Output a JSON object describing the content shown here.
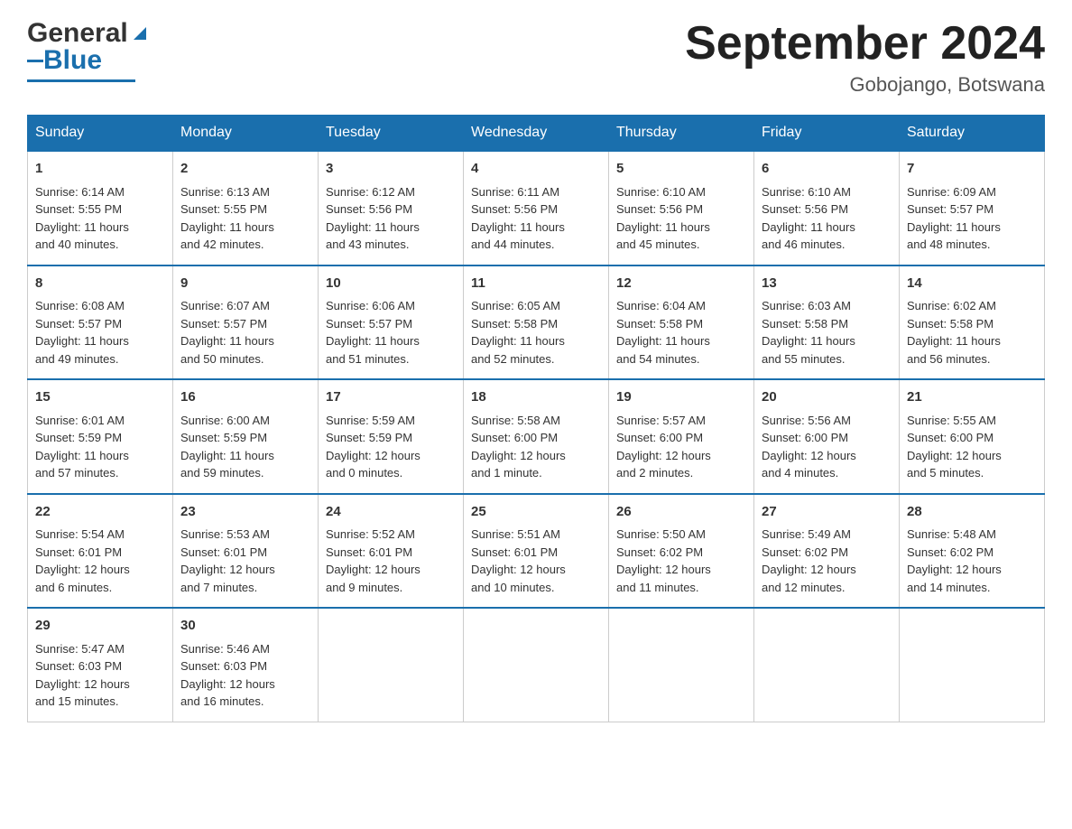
{
  "header": {
    "logo": {
      "general": "General",
      "blue": "Blue"
    },
    "title": "September 2024",
    "location": "Gobojango, Botswana"
  },
  "days_of_week": [
    "Sunday",
    "Monday",
    "Tuesday",
    "Wednesday",
    "Thursday",
    "Friday",
    "Saturday"
  ],
  "weeks": [
    [
      {
        "day": "1",
        "sunrise": "6:14 AM",
        "sunset": "5:55 PM",
        "daylight": "11 hours and 40 minutes."
      },
      {
        "day": "2",
        "sunrise": "6:13 AM",
        "sunset": "5:55 PM",
        "daylight": "11 hours and 42 minutes."
      },
      {
        "day": "3",
        "sunrise": "6:12 AM",
        "sunset": "5:56 PM",
        "daylight": "11 hours and 43 minutes."
      },
      {
        "day": "4",
        "sunrise": "6:11 AM",
        "sunset": "5:56 PM",
        "daylight": "11 hours and 44 minutes."
      },
      {
        "day": "5",
        "sunrise": "6:10 AM",
        "sunset": "5:56 PM",
        "daylight": "11 hours and 45 minutes."
      },
      {
        "day": "6",
        "sunrise": "6:10 AM",
        "sunset": "5:56 PM",
        "daylight": "11 hours and 46 minutes."
      },
      {
        "day": "7",
        "sunrise": "6:09 AM",
        "sunset": "5:57 PM",
        "daylight": "11 hours and 48 minutes."
      }
    ],
    [
      {
        "day": "8",
        "sunrise": "6:08 AM",
        "sunset": "5:57 PM",
        "daylight": "11 hours and 49 minutes."
      },
      {
        "day": "9",
        "sunrise": "6:07 AM",
        "sunset": "5:57 PM",
        "daylight": "11 hours and 50 minutes."
      },
      {
        "day": "10",
        "sunrise": "6:06 AM",
        "sunset": "5:57 PM",
        "daylight": "11 hours and 51 minutes."
      },
      {
        "day": "11",
        "sunrise": "6:05 AM",
        "sunset": "5:58 PM",
        "daylight": "11 hours and 52 minutes."
      },
      {
        "day": "12",
        "sunrise": "6:04 AM",
        "sunset": "5:58 PM",
        "daylight": "11 hours and 54 minutes."
      },
      {
        "day": "13",
        "sunrise": "6:03 AM",
        "sunset": "5:58 PM",
        "daylight": "11 hours and 55 minutes."
      },
      {
        "day": "14",
        "sunrise": "6:02 AM",
        "sunset": "5:58 PM",
        "daylight": "11 hours and 56 minutes."
      }
    ],
    [
      {
        "day": "15",
        "sunrise": "6:01 AM",
        "sunset": "5:59 PM",
        "daylight": "11 hours and 57 minutes."
      },
      {
        "day": "16",
        "sunrise": "6:00 AM",
        "sunset": "5:59 PM",
        "daylight": "11 hours and 59 minutes."
      },
      {
        "day": "17",
        "sunrise": "5:59 AM",
        "sunset": "5:59 PM",
        "daylight": "12 hours and 0 minutes."
      },
      {
        "day": "18",
        "sunrise": "5:58 AM",
        "sunset": "6:00 PM",
        "daylight": "12 hours and 1 minute."
      },
      {
        "day": "19",
        "sunrise": "5:57 AM",
        "sunset": "6:00 PM",
        "daylight": "12 hours and 2 minutes."
      },
      {
        "day": "20",
        "sunrise": "5:56 AM",
        "sunset": "6:00 PM",
        "daylight": "12 hours and 4 minutes."
      },
      {
        "day": "21",
        "sunrise": "5:55 AM",
        "sunset": "6:00 PM",
        "daylight": "12 hours and 5 minutes."
      }
    ],
    [
      {
        "day": "22",
        "sunrise": "5:54 AM",
        "sunset": "6:01 PM",
        "daylight": "12 hours and 6 minutes."
      },
      {
        "day": "23",
        "sunrise": "5:53 AM",
        "sunset": "6:01 PM",
        "daylight": "12 hours and 7 minutes."
      },
      {
        "day": "24",
        "sunrise": "5:52 AM",
        "sunset": "6:01 PM",
        "daylight": "12 hours and 9 minutes."
      },
      {
        "day": "25",
        "sunrise": "5:51 AM",
        "sunset": "6:01 PM",
        "daylight": "12 hours and 10 minutes."
      },
      {
        "day": "26",
        "sunrise": "5:50 AM",
        "sunset": "6:02 PM",
        "daylight": "12 hours and 11 minutes."
      },
      {
        "day": "27",
        "sunrise": "5:49 AM",
        "sunset": "6:02 PM",
        "daylight": "12 hours and 12 minutes."
      },
      {
        "day": "28",
        "sunrise": "5:48 AM",
        "sunset": "6:02 PM",
        "daylight": "12 hours and 14 minutes."
      }
    ],
    [
      {
        "day": "29",
        "sunrise": "5:47 AM",
        "sunset": "6:03 PM",
        "daylight": "12 hours and 15 minutes."
      },
      {
        "day": "30",
        "sunrise": "5:46 AM",
        "sunset": "6:03 PM",
        "daylight": "12 hours and 16 minutes."
      },
      null,
      null,
      null,
      null,
      null
    ]
  ],
  "labels": {
    "sunrise": "Sunrise:",
    "sunset": "Sunset:",
    "daylight": "Daylight:"
  }
}
